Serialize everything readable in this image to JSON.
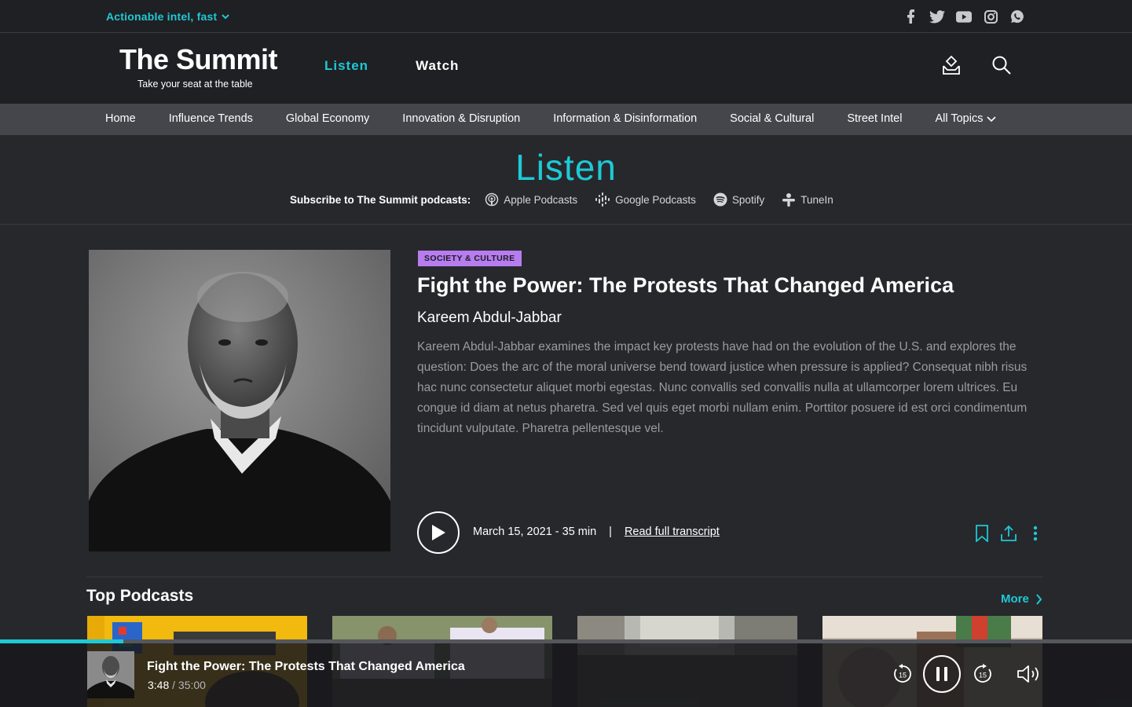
{
  "utility": {
    "tagline": "Actionable intel, fast",
    "social": [
      "facebook-icon",
      "twitter-icon",
      "youtube-icon",
      "instagram-icon",
      "whatsapp-icon"
    ]
  },
  "header": {
    "logo_title": "The Summit",
    "logo_sub": "Take your seat at the table",
    "nav": [
      {
        "label": "Listen",
        "active": true
      },
      {
        "label": "Watch",
        "active": false
      }
    ]
  },
  "categories": [
    "Home",
    "Influence Trends",
    "Global Economy",
    "Innovation & Disruption",
    "Information & Disinformation",
    "Social & Cultural",
    "Street Intel",
    "All Topics"
  ],
  "listen": {
    "title": "Listen",
    "subscribe_label": "Subscribe to The Summit podcasts:",
    "platforms": [
      "Apple Podcasts",
      "Google Podcasts",
      "Spotify",
      "TuneIn"
    ]
  },
  "episode": {
    "badge": "SOCIETY & CULTURE",
    "title": "Fight the Power: The Protests That Changed America",
    "author": "Kareem Abdul-Jabbar",
    "description": "Kareem Abdul-Jabbar examines the impact key protests have had on the evolution of the U.S. and explores the question: Does the arc of the moral universe bend toward justice when pressure is applied? Consequat nibh risus hac nunc consectetur aliquet morbi egestas. Nunc convallis sed convallis nulla at ullamcorper lorem ultrices. Eu congue id diam at netus pharetra. Sed vel quis eget morbi nullam enim. Porttitor posuere id est orci condimentum tincidunt vulputate. Pharetra pellentesque vel.",
    "date_length": "March 15, 2021 - 35 min",
    "separator": "|",
    "transcript_label": "Read full transcript"
  },
  "top_podcasts": {
    "title": "Top Podcasts",
    "more_label": "More"
  },
  "player": {
    "title": "Fight the Power: The Protests That Changed America",
    "current": "3:48",
    "duration": " / 35:00",
    "progress_fraction": 0.109,
    "skip_back": "15",
    "skip_forward": "15"
  },
  "colors": {
    "accent": "#1ec9d6",
    "badge": "#b77cf0",
    "background": "#27282c"
  }
}
